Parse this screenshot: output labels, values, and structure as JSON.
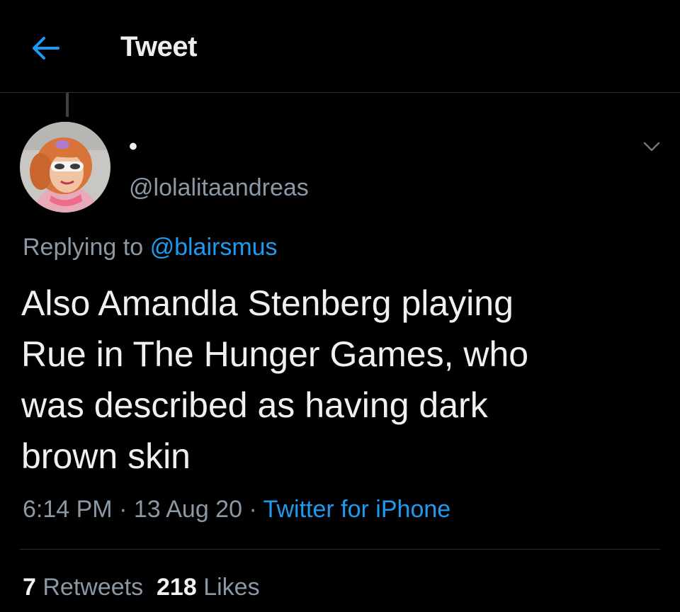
{
  "header": {
    "back_icon": "arrow-left-icon",
    "title": "Tweet",
    "accent_color": "#1d9bf0"
  },
  "tweet": {
    "author": {
      "display_name": "•",
      "handle": "@lolalitaandreas",
      "avatar": "profile-photo"
    },
    "more_icon": "chevron-down-icon",
    "reply": {
      "prefix": "Replying to",
      "target": "@blairsmus"
    },
    "text_lines": [
      "Also Amandla Stenberg playing",
      "Rue in The Hunger Games, who",
      "was described as having dark",
      "brown skin"
    ],
    "meta": {
      "time": "6:14 PM",
      "separator": " · ",
      "date": "13 Aug 20",
      "source": "Twitter for iPhone"
    },
    "stats": {
      "retweets_count": "7",
      "retweets_label": "Retweets",
      "likes_count": "218",
      "likes_label": "Likes"
    }
  },
  "colors": {
    "background": "#000000",
    "text_primary": "#f0f0f0",
    "text_secondary": "#8b98a5",
    "link": "#1d9bf0",
    "divider": "#2a2d30"
  }
}
